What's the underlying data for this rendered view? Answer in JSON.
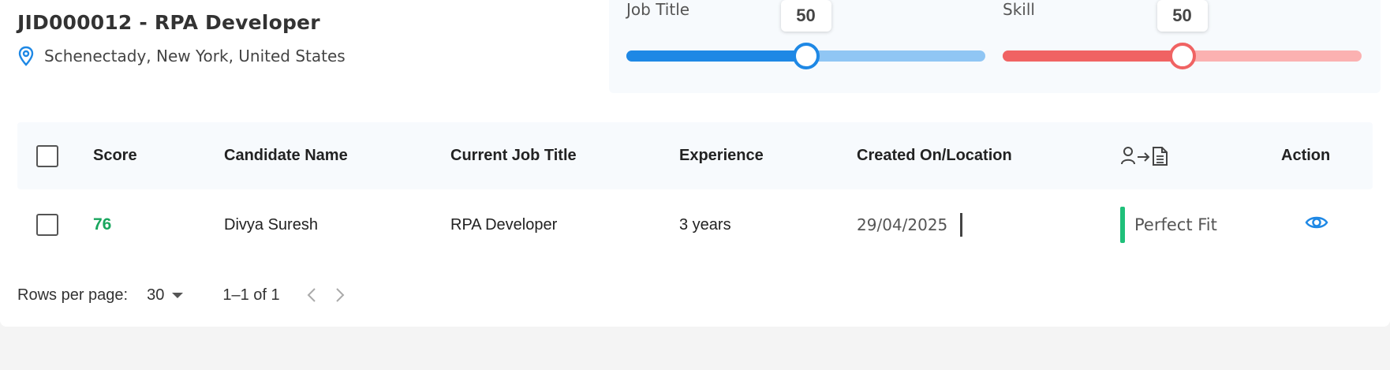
{
  "header": {
    "job_title": "JID000012 - RPA Developer",
    "location": "Schenectady, New York, United States",
    "location_icon": "map-pin-icon"
  },
  "weights": {
    "job_title": {
      "label": "Job Title",
      "value": 50,
      "value_text": "50",
      "color": "#1e88e5",
      "track_color": "#90c6f4"
    },
    "skill": {
      "label": "Skill",
      "value": 50,
      "value_text": "50",
      "color": "#f06363",
      "track_color": "#fbb1b1"
    }
  },
  "table": {
    "headers": {
      "score": "Score",
      "candidate_name": "Candidate Name",
      "current_job_title": "Current Job Title",
      "experience": "Experience",
      "created_on_location": "Created On/Location",
      "match_icon": "person-to-document-icon",
      "action": "Action"
    },
    "rows": [
      {
        "score": "76",
        "candidate_name": "Divya Suresh",
        "current_job_title": "RPA Developer",
        "experience": "3 years",
        "created_on": "29/04/2025",
        "fit": "Perfect Fit",
        "action_icon": "eye-icon"
      }
    ]
  },
  "pagination": {
    "rows_per_page_label": "Rows per page:",
    "rows_per_page_value": "30",
    "range": "1–1 of 1"
  },
  "colors": {
    "score": "#19a65e",
    "fit": "#1fc07a",
    "accent": "#1e88e5"
  }
}
